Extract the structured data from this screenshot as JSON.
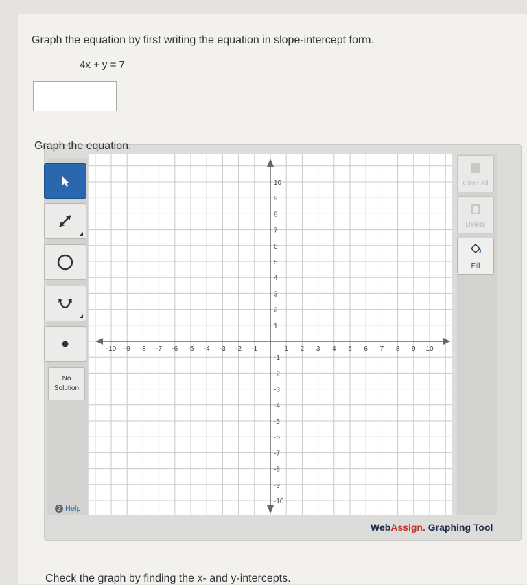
{
  "question": {
    "prompt": "Graph the equation by first writing the equation in slope-intercept form.",
    "equation": "4x + y = 7",
    "answer_value": ""
  },
  "graph_section": {
    "heading": "Graph the equation."
  },
  "tools": {
    "no_solution_line1": "No",
    "no_solution_line2": "Solution",
    "help_label": "Help"
  },
  "right_tools": {
    "clear_all_label": "Clear All",
    "delete_label": "Delete",
    "fill_label": "Fill"
  },
  "axes": {
    "x_range": [
      -10,
      10
    ],
    "y_range": [
      -10,
      10
    ],
    "grid": true
  },
  "brand": {
    "web": "Web",
    "assign": "Assign.",
    "tool": " Graphing Tool"
  },
  "footer": {
    "text": "Check the graph by finding the x- and y-intercepts."
  },
  "colors": {
    "selected_tool": "#2a67ae",
    "brand_red": "#c9302c",
    "brand_navy": "#1c2b4a"
  }
}
